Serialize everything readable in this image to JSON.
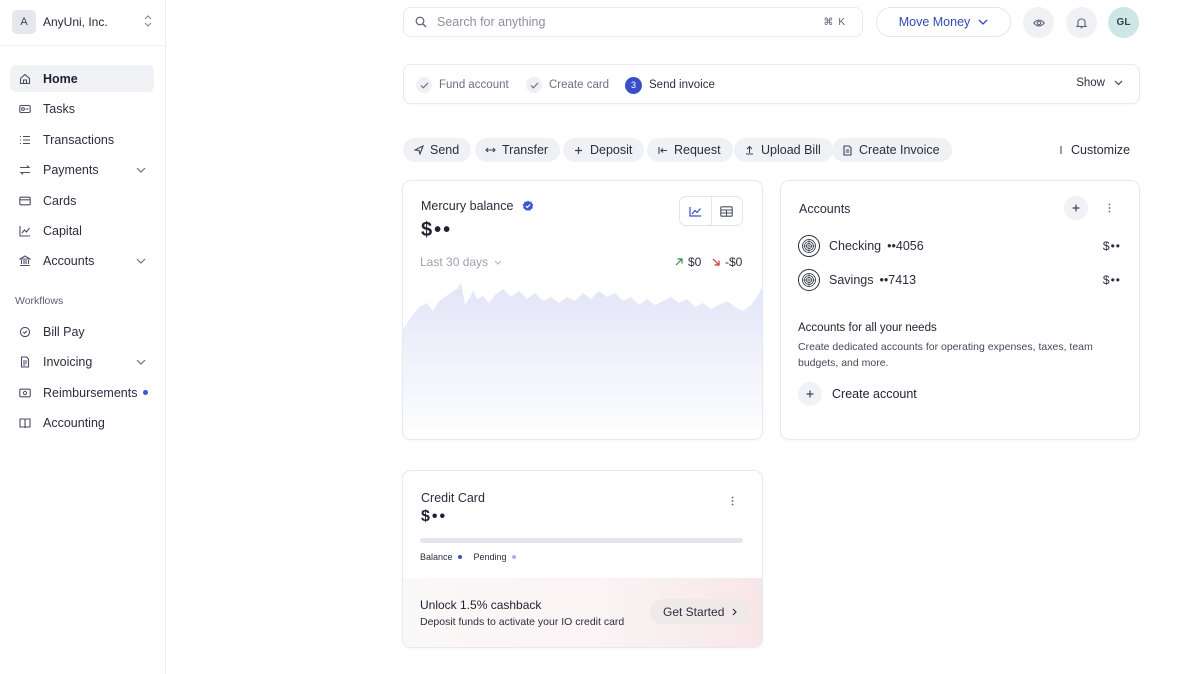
{
  "org": {
    "initial": "A",
    "name": "AnyUni, Inc."
  },
  "sidebar": {
    "items": [
      {
        "label": "Home",
        "icon": "home-icon"
      },
      {
        "label": "Tasks",
        "icon": "tasks-icon"
      },
      {
        "label": "Transactions",
        "icon": "list-icon"
      },
      {
        "label": "Payments",
        "icon": "arrows-icon"
      },
      {
        "label": "Cards",
        "icon": "card-icon"
      },
      {
        "label": "Capital",
        "icon": "chart-icon"
      },
      {
        "label": "Accounts",
        "icon": "bank-icon"
      }
    ],
    "workflows_label": "Workflows",
    "workflows": [
      {
        "label": "Bill Pay",
        "icon": "bill-icon"
      },
      {
        "label": "Invoicing",
        "icon": "invoice-icon"
      },
      {
        "label": "Reimbursements",
        "icon": "receipt-icon"
      },
      {
        "label": "Accounting",
        "icon": "book-icon"
      }
    ]
  },
  "search": {
    "placeholder": "Search for anything",
    "shortcut": "⌘K"
  },
  "header": {
    "move_money": "Move Money",
    "avatar_initials": "GL"
  },
  "onboarding": {
    "steps": [
      {
        "label": "Fund account",
        "state": "done"
      },
      {
        "label": "Create card",
        "state": "done"
      },
      {
        "label": "Send invoice",
        "state": "current",
        "number": "3"
      }
    ],
    "show_label": "Show"
  },
  "actions": {
    "send": "Send",
    "transfer": "Transfer",
    "deposit": "Deposit",
    "request": "Request",
    "upload_bill": "Upload Bill",
    "create_invoice": "Create Invoice",
    "customize": "Customize"
  },
  "mercury": {
    "title": "Mercury balance",
    "balance": "$••",
    "period": "Last 30 days",
    "money_in": "$0",
    "money_out": "-$0"
  },
  "accounts": {
    "title": "Accounts",
    "list": [
      {
        "name": "Checking",
        "mask": "••4056",
        "amount": "$••"
      },
      {
        "name": "Savings",
        "mask": "••7413",
        "amount": "$••"
      }
    ],
    "promo_title": "Accounts for all your needs",
    "promo_desc": "Create dedicated accounts for operating expenses, taxes, team budgets, and more.",
    "create_label": "Create account"
  },
  "credit_card": {
    "title": "Credit Card",
    "balance": "$••",
    "legend_balance": "Balance",
    "legend_pending": "Pending",
    "cashback_title": "Unlock 1.5% cashback",
    "cashback_desc": "Deposit funds to activate your IO credit card",
    "get_started": "Get Started"
  },
  "colors": {
    "accent": "#3a4fc7",
    "chart_fill": "#e5e7f8"
  }
}
